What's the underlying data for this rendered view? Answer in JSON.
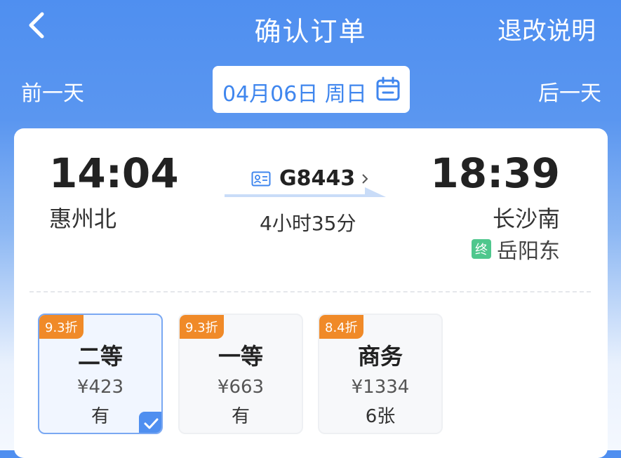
{
  "header": {
    "title": "确认订单",
    "policy_label": "退改说明",
    "back_icon": "chevron-left-icon"
  },
  "date_bar": {
    "prev_label": "前一天",
    "next_label": "后一天",
    "date": "04月06日 周日",
    "calendar_icon": "calendar-icon"
  },
  "trip": {
    "departure_time": "14:04",
    "departure_station": "惠州北",
    "arrival_time": "18:39",
    "arrival_station": "长沙南",
    "train_number": "G8443",
    "duration": "4小时35分",
    "terminal_badge": "终",
    "terminal_station": "岳阳东"
  },
  "seats": [
    {
      "discount": "9.3折",
      "name": "二等",
      "price": "¥423",
      "availability": "有",
      "selected": true
    },
    {
      "discount": "9.3折",
      "name": "一等",
      "price": "¥663",
      "availability": "有",
      "selected": false
    },
    {
      "discount": "8.4折",
      "name": "商务",
      "price": "¥1334",
      "availability": "6张",
      "selected": false
    }
  ],
  "colors": {
    "brand_blue": "#4f8ff0",
    "date_text": "#3f86ee",
    "discount_orange": "#f08a28",
    "terminal_green": "#4ec78d"
  }
}
